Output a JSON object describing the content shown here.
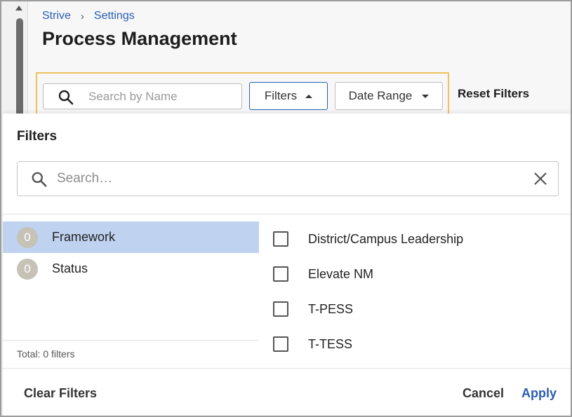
{
  "breadcrumb": {
    "root": "Strive",
    "separator": "›",
    "current": "Settings"
  },
  "page": {
    "title": "Process Management"
  },
  "toolbar": {
    "search_placeholder": "Search by Name",
    "filters_label": "Filters",
    "date_range_label": "Date Range",
    "reset_label": "Reset Filters"
  },
  "panel": {
    "title": "Filters",
    "search_placeholder": "Search…",
    "categories": [
      {
        "count": "0",
        "label": "Framework",
        "selected": true
      },
      {
        "count": "0",
        "label": "Status",
        "selected": false
      }
    ],
    "total": "Total: 0 filters",
    "options": [
      {
        "label": "District/Campus Leadership",
        "checked": false
      },
      {
        "label": "Elevate NM",
        "checked": false
      },
      {
        "label": "T-PESS",
        "checked": false
      },
      {
        "label": "T-TESS",
        "checked": false
      }
    ],
    "clear_label": "Clear Filters",
    "cancel_label": "Cancel",
    "apply_label": "Apply"
  },
  "icons": {
    "search": "search-icon",
    "clear": "close-icon",
    "filters_caret": "caret-up-icon",
    "date_caret": "caret-down-icon"
  },
  "colors": {
    "accent": "#2a5db0",
    "highlight_border": "#f0c25c",
    "selected_row": "#bfd2f0",
    "badge": "#c6c2b6"
  }
}
